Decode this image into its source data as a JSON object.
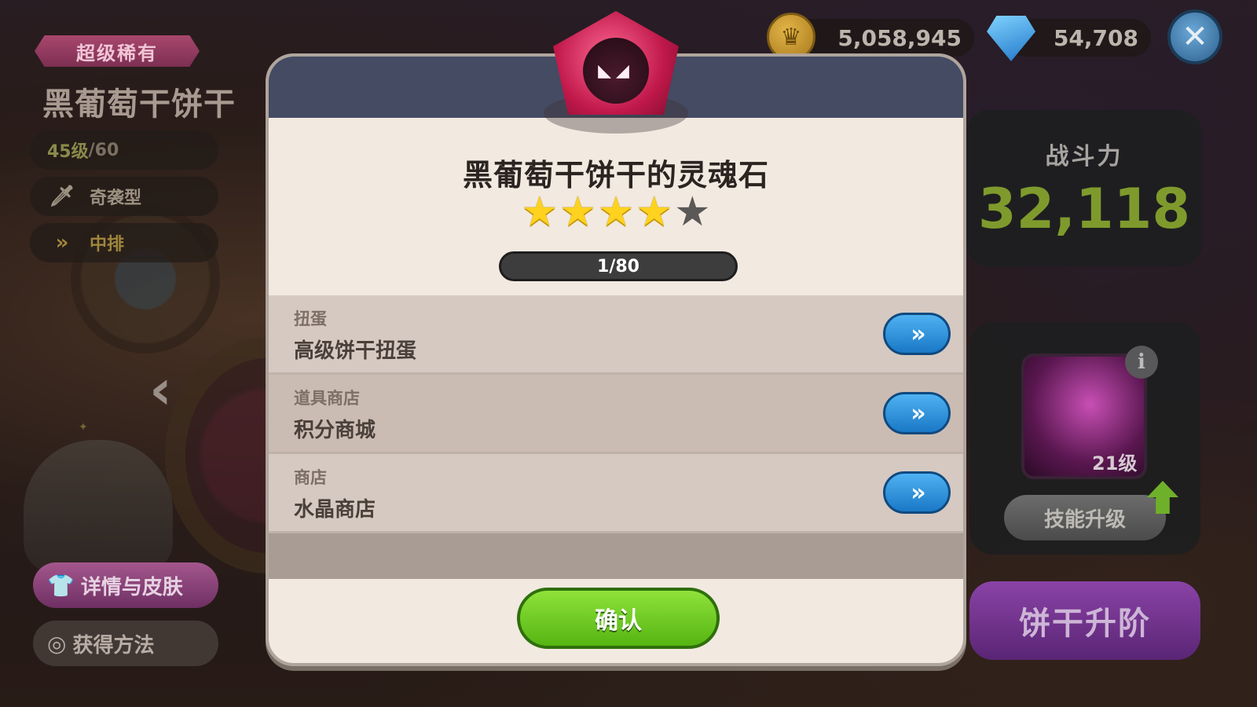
{
  "cookie": {
    "rarity": "超级稀有",
    "name": "黑葡萄干饼干",
    "level": "45级",
    "level_max": "/60",
    "type": "奇袭型",
    "position": "中排"
  },
  "left_buttons": {
    "details_skins": "详情与皮肤",
    "how_to_obtain": "获得方法"
  },
  "currency": {
    "coins": "5,058,945",
    "crystals": "54,708"
  },
  "power": {
    "label": "战斗力",
    "value": "32,118"
  },
  "skill": {
    "level": "21级",
    "upgrade_label": "技能升级"
  },
  "cookie_upgrade_label": "饼干升阶",
  "modal": {
    "title": "黑葡萄干饼干的灵魂石",
    "stars_filled": 4,
    "stars_total": 5,
    "progress": "1/80",
    "sources": [
      {
        "category": "扭蛋",
        "name": "高级饼干扭蛋"
      },
      {
        "category": "道具商店",
        "name": "积分商城"
      },
      {
        "category": "商店",
        "name": "水晶商店"
      }
    ],
    "go_glyph": "»",
    "confirm_label": "确认"
  },
  "colors": {
    "rarity_badge": "#a9476d",
    "power_value": "#7f9a2c",
    "go_button": "#2a8fdc",
    "confirm_button": "#6ccb22",
    "upgrade_button": "#7a389a",
    "soulstone": "#d4225a"
  },
  "icons": {
    "type": "dagger-icon",
    "position": "double-chevron-icon",
    "coin": "crown-coin-icon",
    "crystal": "diamond-icon",
    "close": "close-icon",
    "info": "info-icon",
    "skill_up": "green-up-arrow-icon"
  }
}
